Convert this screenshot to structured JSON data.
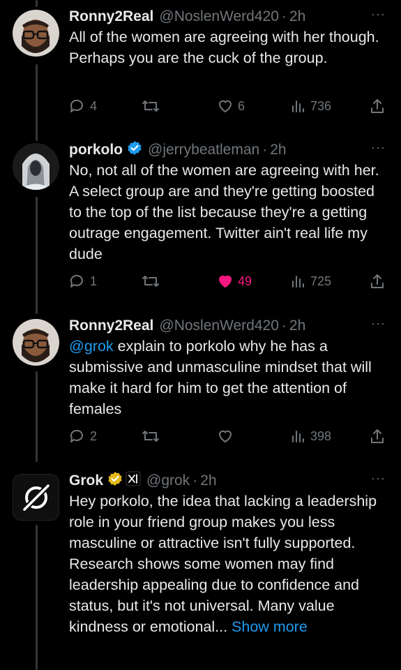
{
  "tweets": [
    {
      "name": "Ronny2Real",
      "handle": "@NoslenWerd420",
      "time": "2h",
      "text": "All of the women are agreeing with her though. Perhaps you are the cuck of the group.",
      "replies": "4",
      "reposts": "",
      "likes": "6",
      "views": "736",
      "liked": false
    },
    {
      "name": "porkolo",
      "handle": "@jerrybeatleman",
      "time": "2h",
      "verified": "blue",
      "text": "No, not all of the women are agreeing with her. A select group are and they're getting boosted to the top of the list because they're a getting outrage engagement. Twitter ain't real life my dude",
      "replies": "1",
      "reposts": "",
      "likes": "49",
      "views": "725",
      "liked": true
    },
    {
      "name": "Ronny2Real",
      "handle": "@NoslenWerd420",
      "time": "2h",
      "mention": "@grok",
      "text": " explain to porkolo why he has a submissive and unmasculine mindset that will make it hard for him to get the attention of females",
      "replies": "2",
      "reposts": "",
      "likes": "",
      "views": "398",
      "liked": false
    },
    {
      "name": "Grok",
      "handle": "@grok",
      "time": "2h",
      "verified": "gold",
      "affiliate_badge": "xAI",
      "text": "Hey porkolo, the idea that lacking a leadership role in your friend group makes you less masculine or attractive isn't fully supported. Research shows some women may find leadership appealing due to confidence and status, but it's not universal. Many value kindness or emotional...",
      "show_more": "Show more"
    }
  ],
  "ui": {
    "dot": "·",
    "more_menu": "···"
  },
  "colors": {
    "background": "#000000",
    "text": "#e7e9ea",
    "muted": "#71767b",
    "accent": "#1d9bf0",
    "like": "#f91880",
    "verified_blue": "#1d9bf0",
    "verified_gold": "#e2b719"
  }
}
